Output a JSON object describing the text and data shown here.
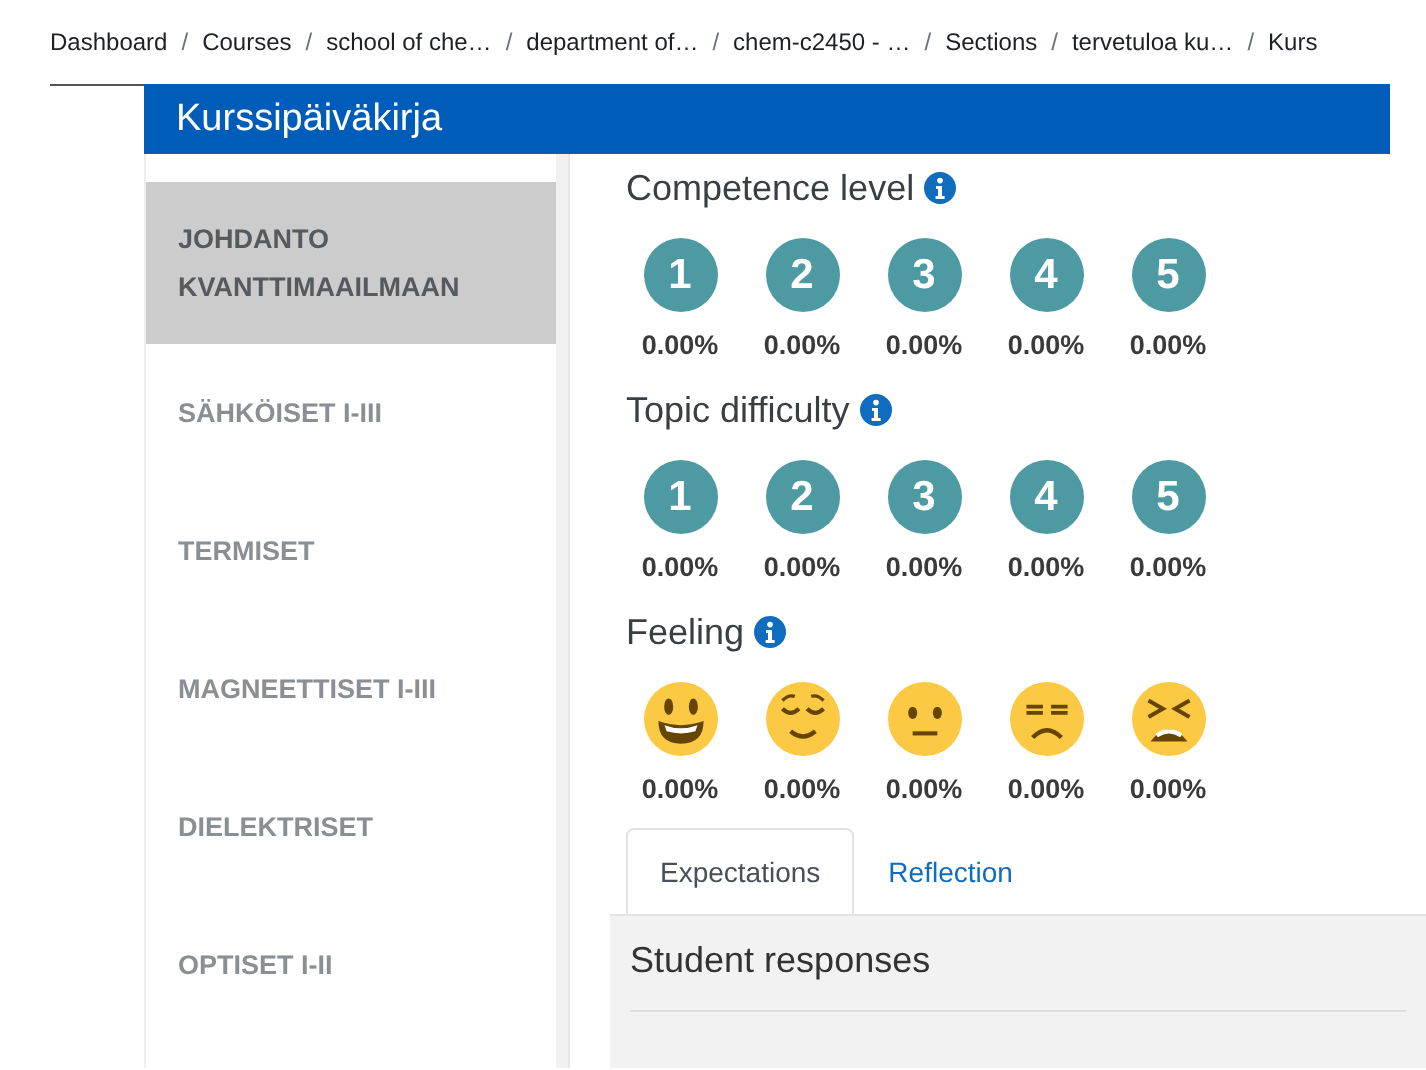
{
  "breadcrumb_separator": "/",
  "breadcrumb": [
    "Dashboard",
    "Courses",
    "school of che…",
    "department of…",
    "chem-c2450 - …",
    "Sections",
    "tervetuloa ku…",
    "Kurs"
  ],
  "banner": {
    "title": "Kurssipäiväkirja"
  },
  "sidebar": {
    "items": [
      {
        "label": "JOHDANTO KVANTTIMAAILMAAN",
        "selected": true
      },
      {
        "label": "SÄHKÖISET I-III",
        "selected": false
      },
      {
        "label": "TERMISET",
        "selected": false
      },
      {
        "label": "MAGNEETTISET I-III",
        "selected": false
      },
      {
        "label": "DIELEKTRISET",
        "selected": false
      },
      {
        "label": "OPTISET I-II",
        "selected": false
      }
    ]
  },
  "sections": [
    {
      "title": "Competence level",
      "kind": "number",
      "options": [
        {
          "label": "1",
          "percent": "0.00%"
        },
        {
          "label": "2",
          "percent": "0.00%"
        },
        {
          "label": "3",
          "percent": "0.00%"
        },
        {
          "label": "4",
          "percent": "0.00%"
        },
        {
          "label": "5",
          "percent": "0.00%"
        }
      ]
    },
    {
      "title": "Topic difficulty",
      "kind": "number",
      "options": [
        {
          "label": "1",
          "percent": "0.00%"
        },
        {
          "label": "2",
          "percent": "0.00%"
        },
        {
          "label": "3",
          "percent": "0.00%"
        },
        {
          "label": "4",
          "percent": "0.00%"
        },
        {
          "label": "5",
          "percent": "0.00%"
        }
      ]
    },
    {
      "title": "Feeling",
      "kind": "emoji",
      "options": [
        {
          "percent": "0.00%"
        },
        {
          "percent": "0.00%"
        },
        {
          "percent": "0.00%"
        },
        {
          "percent": "0.00%"
        },
        {
          "percent": "0.00%"
        }
      ]
    }
  ],
  "tabs": [
    {
      "label": "Expectations",
      "selected": true
    },
    {
      "label": "Reflection",
      "selected": false
    }
  ],
  "panel": {
    "title": "Student responses"
  }
}
